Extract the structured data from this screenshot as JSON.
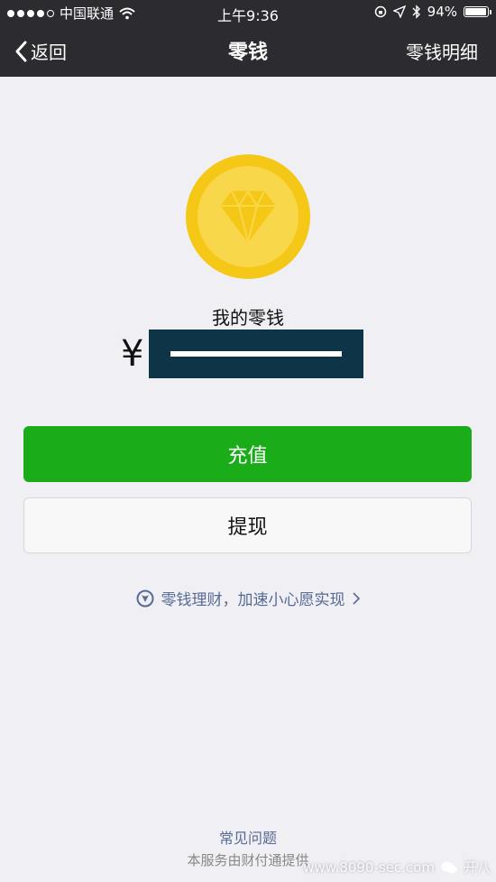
{
  "status_bar": {
    "carrier": "中国联通",
    "time": "上午9:36",
    "battery": "94%",
    "battery_level": 0.94
  },
  "nav": {
    "back_label": "返回",
    "title": "零钱",
    "detail_label": "零钱明细"
  },
  "wallet": {
    "caption": "我的零钱",
    "currency_symbol": "¥",
    "coin_color": "#f5c817"
  },
  "actions": {
    "recharge_label": "充值",
    "withdraw_label": "提现",
    "primary_color": "#1aad19"
  },
  "promo": {
    "text": "零钱理财，加速小心愿实现",
    "icon": "wealth-icon"
  },
  "footer": {
    "faq_label": "常见问题",
    "provider_text": "本服务由财付通提供"
  },
  "watermark": {
    "text": "开八",
    "url": "www.8090-sec.com"
  }
}
